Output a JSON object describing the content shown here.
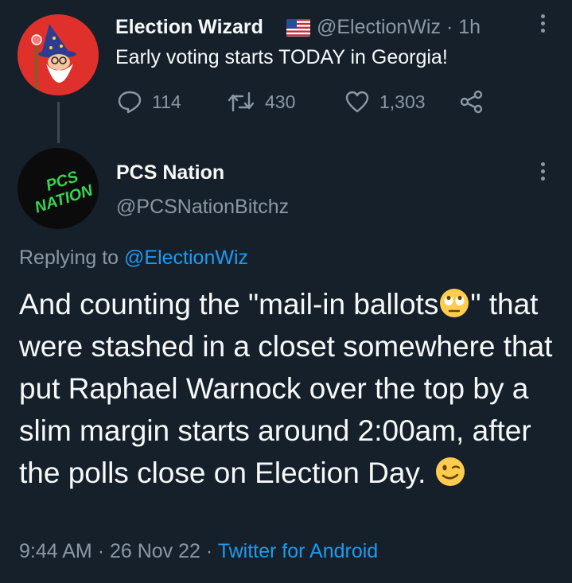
{
  "parent": {
    "name": "Election Wizard",
    "flag_icon": "us-flag-icon",
    "handle": "@ElectionWiz",
    "time": "· 1h",
    "text": "Early voting starts TODAY in Georgia!",
    "actions": {
      "replies": "114",
      "retweets": "430",
      "likes": "1,303"
    }
  },
  "reply": {
    "name": "PCS Nation",
    "handle": "@PCSNationBitchz",
    "avatar_text_top": "PCS",
    "avatar_text_bottom": "NATION",
    "replying_prefix": "Replying to",
    "replying_to": "@ElectionWiz",
    "text_part1": "And counting the \"mail-in ballots",
    "text_part2": "\" that were stashed in a closet somewhere that put Raphael Warnock over the top by a slim margin starts around 2:00am, after the polls close on Election Day. ",
    "emoji_1": "face-with-rolling-eyes",
    "emoji_2": "winking-face",
    "timestamp": "9:44 AM",
    "date": "26 Nov 22",
    "source": "Twitter for Android"
  },
  "colors": {
    "background": "#15202b",
    "text": "#f7f9f9",
    "muted": "#8b98a5",
    "accent": "#1d9bf0",
    "wizard_avatar_bg": "#e0302c",
    "pcs_text": "#39d353"
  }
}
